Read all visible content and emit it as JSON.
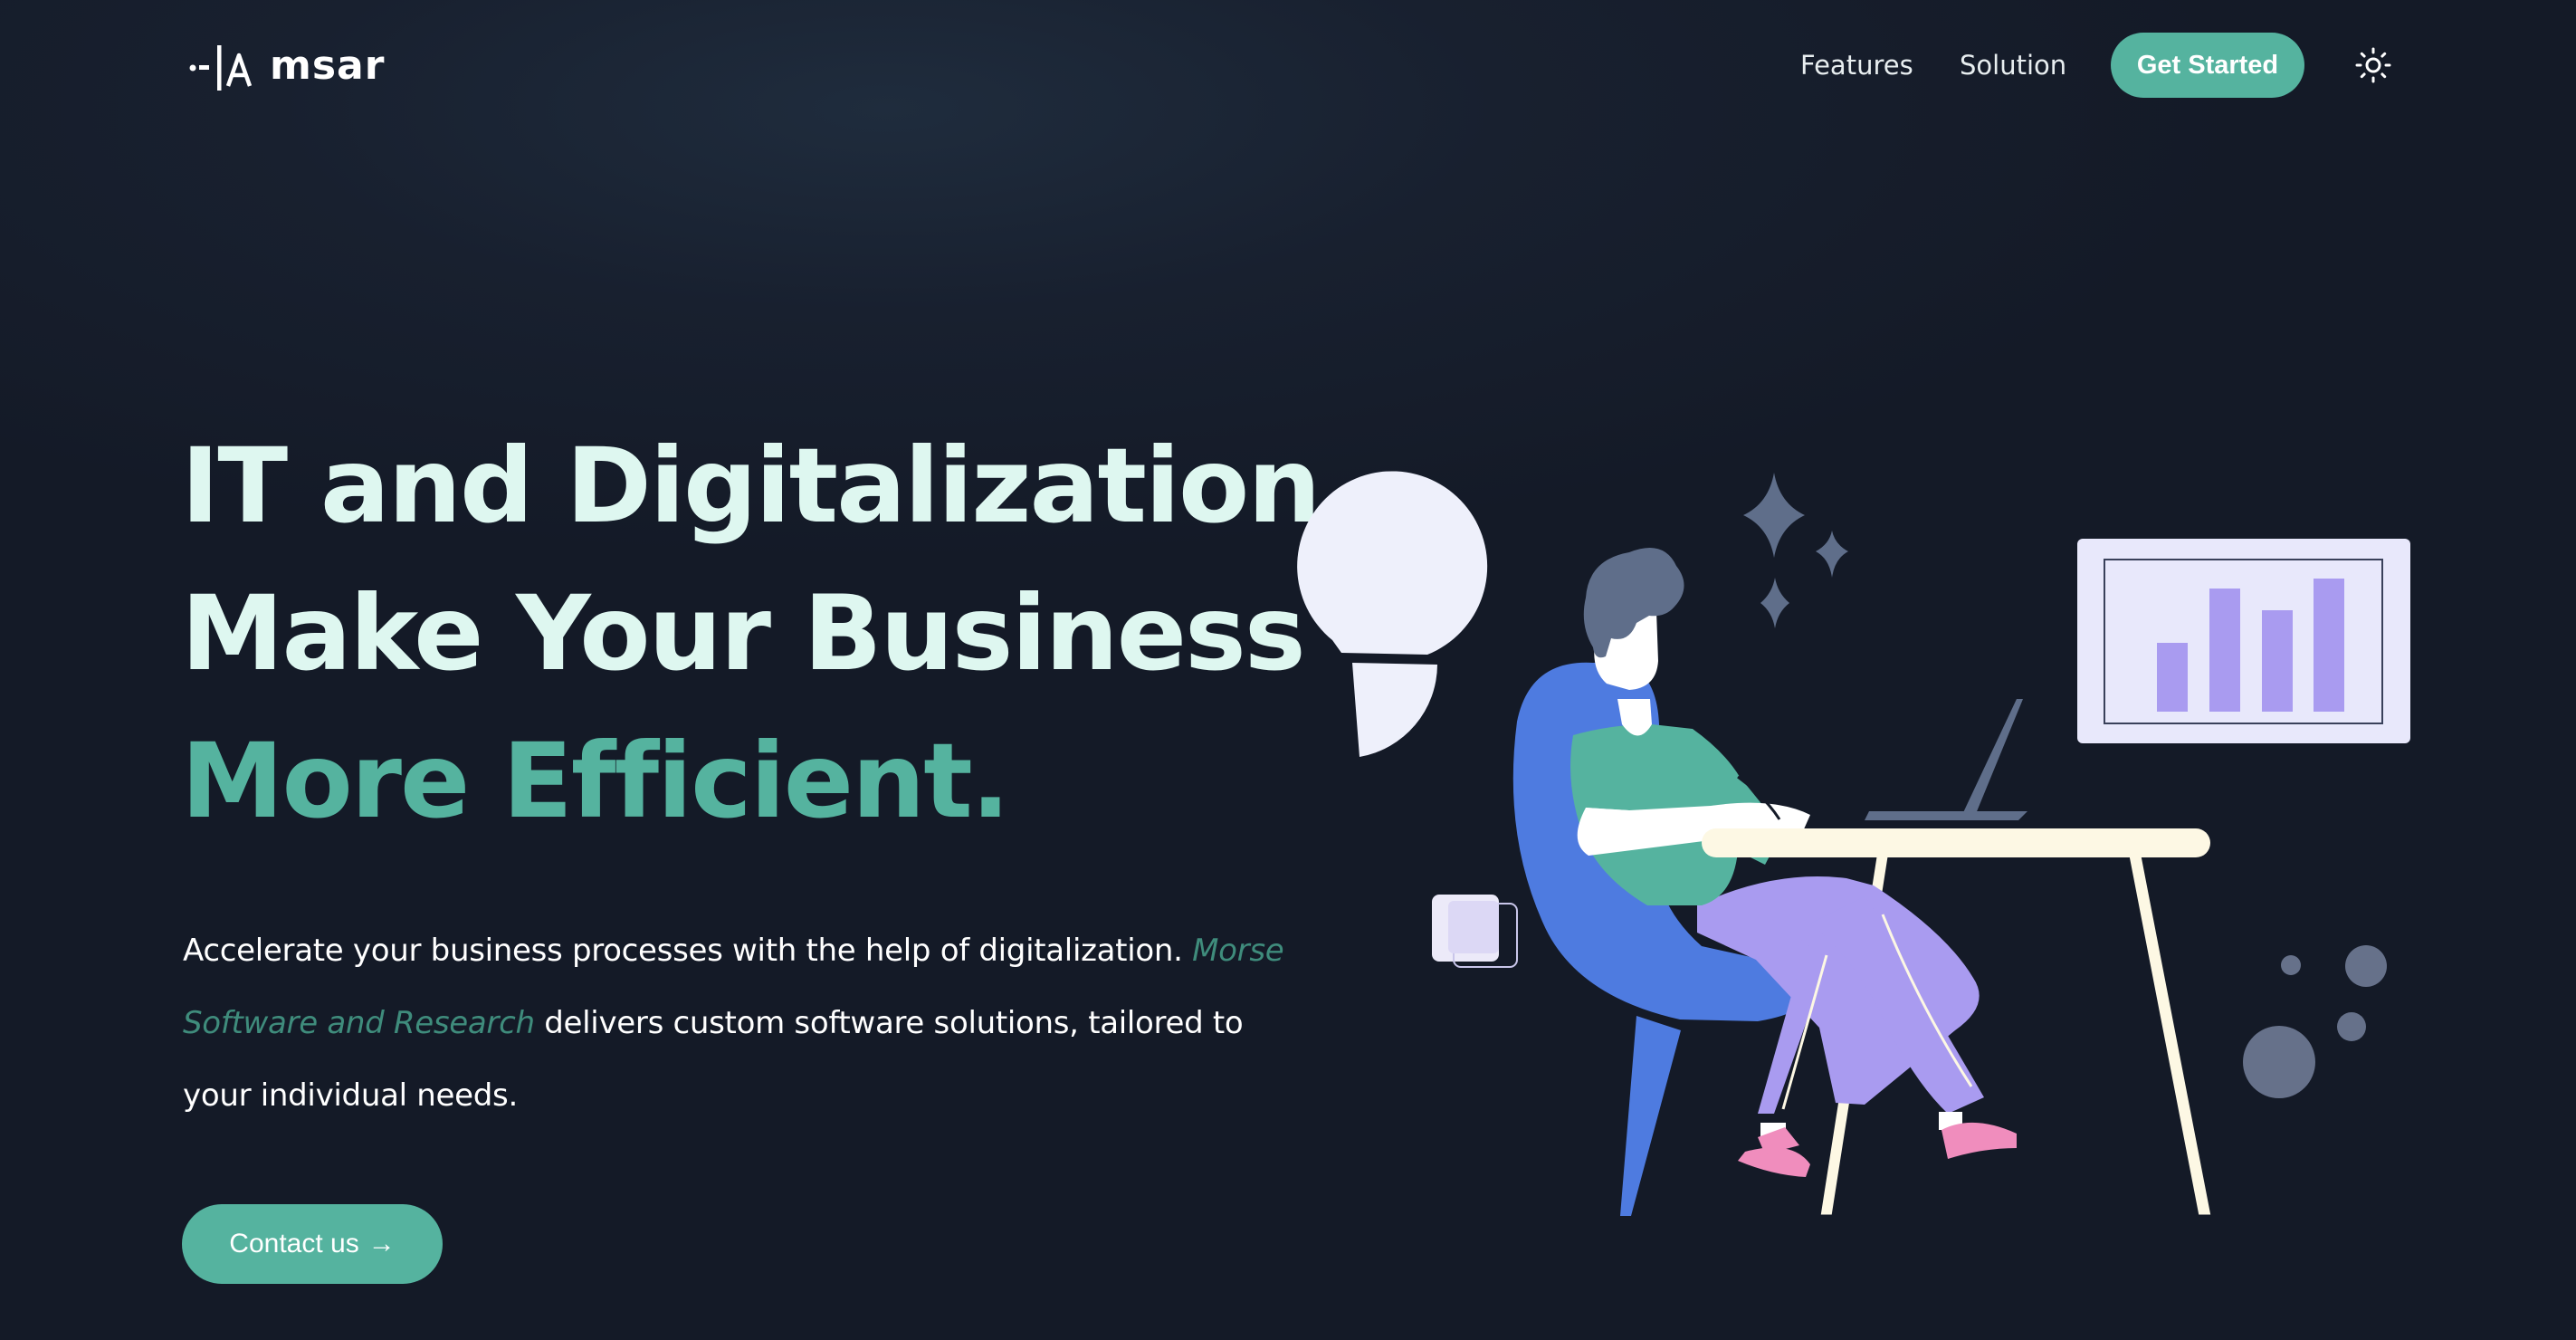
{
  "header": {
    "logo_text": "msar",
    "nav": {
      "features": "Features",
      "solution": "Solution"
    },
    "cta_label": "Get Started"
  },
  "hero": {
    "title_line1": "IT and Digitalization",
    "title_line2": "Make Your Business",
    "title_line3": "More Efficient.",
    "description_part1": "Accelerate your business processes with the help of digitalization.",
    "company_name": "Morse Software and Research",
    "description_part2": "delivers custom software solutions, tailored to your individual needs.",
    "contact_label": "Contact us",
    "contact_arrow": "→"
  },
  "colors": {
    "background": "#141a27",
    "accent": "#55b39f",
    "title": "#def7f0",
    "company_text": "#3f8c7c",
    "chair": "#4e7be0",
    "pants": "#a99bf0",
    "shirt": "#55b39f",
    "desk": "#fdf8e4",
    "bars": "#a99bf0"
  },
  "icons": {
    "theme_toggle": "sun-icon",
    "logo": "logo-mark-icon"
  }
}
